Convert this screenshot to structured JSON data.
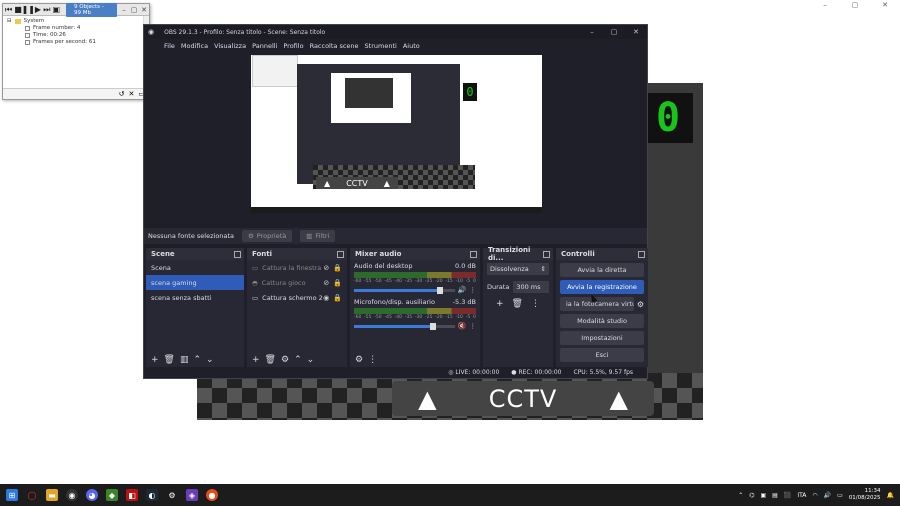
{
  "stats_window": {
    "object_count": "9 Objects - 99 Mb",
    "tree": [
      {
        "label": "System",
        "level": 0
      },
      {
        "label": "Frame number: 4",
        "level": 1
      },
      {
        "label": "Time: 00:26",
        "level": 1
      },
      {
        "label": "Frames per second: 61",
        "level": 1
      }
    ]
  },
  "obs": {
    "title": "OBS 29.1.3 - Profilo: Senza titolo - Scene: Senza titolo",
    "menu": [
      "File",
      "Modifica",
      "Visualizza",
      "Pannelli",
      "Profilo",
      "Raccolta scene",
      "Strumenti",
      "Aiuto"
    ],
    "preview": {
      "cctv_label": "CCTV",
      "digit": "0"
    },
    "source_bar": {
      "no_source": "Nessuna fonte selezionata",
      "properties": "Proprietà",
      "filters": "Filtri"
    },
    "scenes": {
      "title": "Scene",
      "items": [
        "Scena",
        "scena gaming",
        "scena senza sbatti"
      ],
      "selected": "scena gaming"
    },
    "sources": {
      "title": "Fonti",
      "items": [
        "Cattura la finestra",
        "Cattura gioco",
        "Cattura schermo 2"
      ]
    },
    "mixer": {
      "title": "Mixer audio",
      "tracks": [
        {
          "name": "Audio del desktop",
          "db": "0.0 dB",
          "level": 0.85,
          "muted": false
        },
        {
          "name": "Microfono/disp. ausiliario",
          "db": "-5.3 dB",
          "level": 0.78,
          "muted": true
        }
      ],
      "scale": [
        "-60",
        "-55",
        "-50",
        "-45",
        "-40",
        "-35",
        "-30",
        "-25",
        "-20",
        "-15",
        "-10",
        "-5",
        "0"
      ]
    },
    "transitions": {
      "title": "Transizioni di...",
      "selected": "Dissolvenza",
      "duration_label": "Durata",
      "duration_value": "300 ms"
    },
    "controls": {
      "title": "Controlli",
      "start_stream": "Avvia la diretta",
      "start_recording": "Avvia la registrazione",
      "virtual_camera": "ia la fotocamera virtu",
      "studio_mode": "Modalità studio",
      "settings": "Impostazioni",
      "exit": "Esci"
    },
    "status": {
      "live": "LIVE: 00:00:00",
      "rec": "REC: 00:00:00",
      "cpu": "CPU: 5.5%, 9.57 fps"
    }
  },
  "game": {
    "cctv_label": "CCTV",
    "digit": "0"
  },
  "taskbar": {
    "lang": "ITA",
    "time": "11:34",
    "date": "01/08/2025"
  }
}
